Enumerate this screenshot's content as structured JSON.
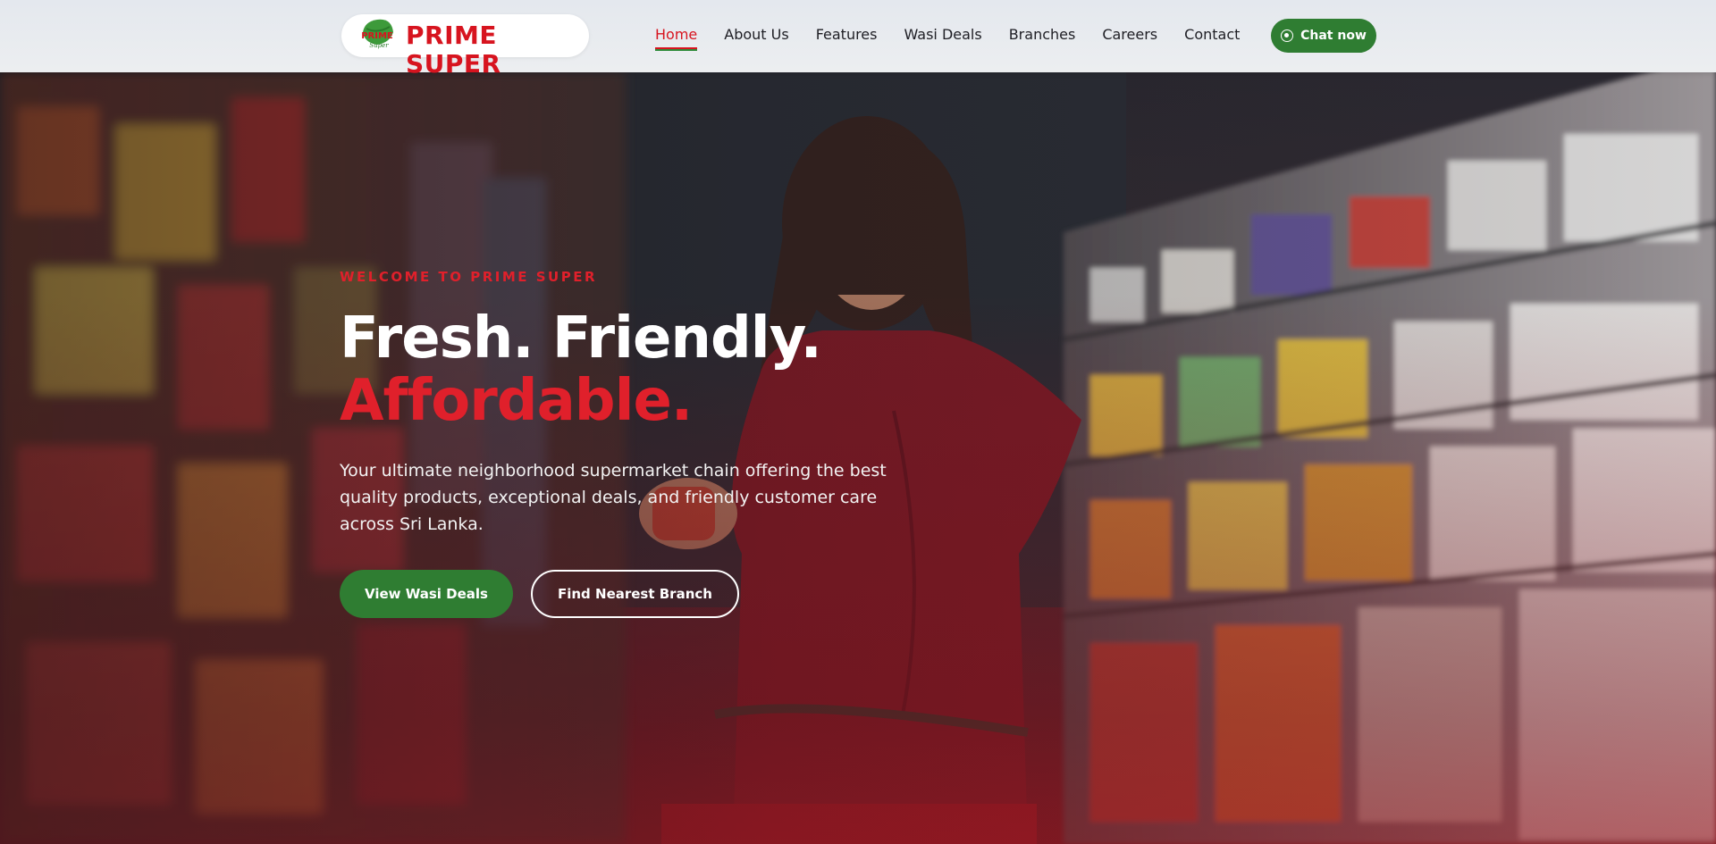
{
  "brand": {
    "name": "PRIME SUPER",
    "mark_text": "PRIME",
    "mark_subtext": "Super",
    "primary_color": "#d7141f",
    "secondary_color": "#2f7d32"
  },
  "nav": {
    "items": [
      {
        "label": "Home",
        "active": true
      },
      {
        "label": "About Us",
        "active": false
      },
      {
        "label": "Features",
        "active": false
      },
      {
        "label": "Wasi Deals",
        "active": false
      },
      {
        "label": "Branches",
        "active": false
      },
      {
        "label": "Careers",
        "active": false
      },
      {
        "label": "Contact",
        "active": false
      }
    ]
  },
  "header": {
    "chat_label": "Chat now",
    "chat_icon": "whatsapp-icon"
  },
  "hero": {
    "eyebrow": "WELCOME TO PRIME SUPER",
    "headline_line1": "Fresh. Friendly.",
    "headline_line2": "Affordable.",
    "lede": "Your ultimate neighborhood supermarket chain offering the best quality products, exceptional deals, and friendly customer care across Sri Lanka.",
    "primary_cta": "View Wasi Deals",
    "secondary_cta": "Find Nearest Branch"
  }
}
